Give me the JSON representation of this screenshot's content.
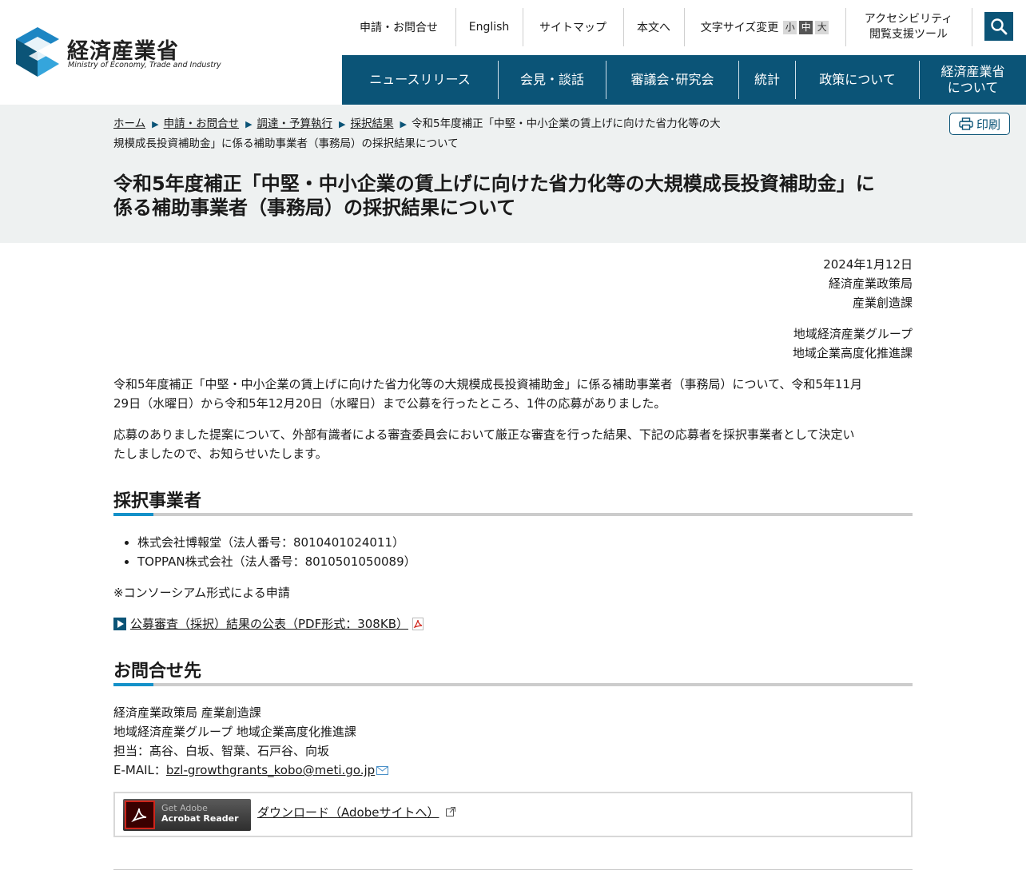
{
  "header": {
    "logo_title": "経済産業省",
    "logo_subtitle": "Ministry of Economy, Trade and Industry",
    "utility": {
      "contact": "申請・お問合せ",
      "english": "English",
      "sitemap": "サイトマップ",
      "skip": "本文へ",
      "font_size_label": "文字サイズ変更",
      "font_small": "小",
      "font_medium": "中",
      "font_large": "大",
      "accessibility_line1": "アクセシビリティ",
      "accessibility_line2": "閲覧支援ツール"
    },
    "search_icon": "search-icon"
  },
  "nav": {
    "items": [
      {
        "label": "ニュースリリース"
      },
      {
        "label": "会見・談話"
      },
      {
        "label": "審議会･研究会"
      },
      {
        "label": "統計"
      },
      {
        "label": "政策について"
      },
      {
        "label_line1": "経済産業省",
        "label_line2": "について"
      }
    ]
  },
  "breadcrumb": {
    "items": [
      "ホーム",
      "申請・お問合せ",
      "調達・予算執行",
      "採択結果"
    ],
    "current_line1": "令和5年度補正「中堅・中小企業の賃上げに向けた省力化等の大",
    "current_line2": "規模成長投資補助金」に係る補助事業者（事務局）の採択結果について"
  },
  "print_label": "印刷",
  "page": {
    "title_line1": "令和5年度補正「中堅・中小企業の賃上げに向けた省力化等の大規模成長投資補助金」に",
    "title_line2": "係る補助事業者（事務局）の採択結果について",
    "date": "2024年1月12日",
    "dept1_line1": "経済産業政策局",
    "dept1_line2": "産業創造課",
    "dept2_line1": "地域経済産業グループ",
    "dept2_line2": "地域企業高度化推進課",
    "para1_line1": "令和5年度補正「中堅・中小企業の賃上げに向けた省力化等の大規模成長投資補助金」に係る補助事業者（事務局）について、令和5年11月",
    "para1_line2": "29日（水曜日）から令和5年12月20日（水曜日）まで公募を行ったところ、1件の応募がありました。",
    "para2_line1": "応募のありました提案について、外部有識者による審査委員会において厳正な審査を行った結果、下記の応募者を採択事業者として決定い",
    "para2_line2": "たしましたので、お知らせいたします。",
    "section1_heading": "採択事業者",
    "awardees": [
      "株式会社博報堂（法人番号：8010401024011）",
      "TOPPAN株式会社（法人番号：8010501050089）"
    ],
    "note": "※コンソーシアム形式による申請",
    "pdf_link": "公募審査（採択）結果の公表（PDF形式：308KB）",
    "section2_heading": "お問合せ先",
    "contact_line1": "経済産業政策局 産業創造課",
    "contact_line2": "地域経済産業グループ 地域企業高度化推進課",
    "contact_line3": "担当：髙谷、白坂、智葉、石戸谷、向坂",
    "email_label": "E-MAIL：",
    "email": "bzl-growthgrants_kobo@meti.go.jp"
  },
  "adobe": {
    "badge_line1": "Get Adobe",
    "badge_line2": "Acrobat Reader",
    "download_link": "ダウンロード（Adobeサイトへ）"
  },
  "colors": {
    "brand": "#0b5477",
    "accent": "#1491c9",
    "band": "#eef1f1"
  }
}
